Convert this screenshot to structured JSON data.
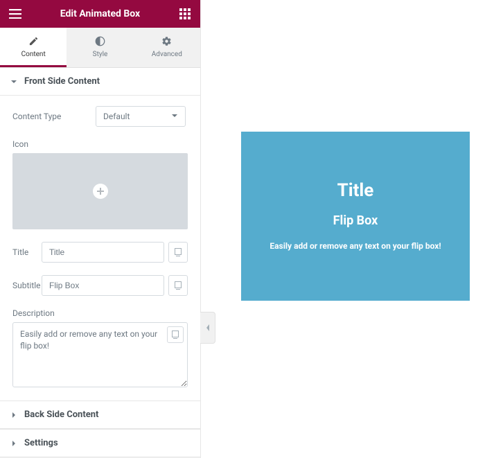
{
  "header": {
    "title": "Edit Animated Box",
    "menu_icon": "hamburger-icon",
    "grid_icon": "grid-icon"
  },
  "tabs": {
    "content": {
      "label": "Content"
    },
    "style": {
      "label": "Style"
    },
    "advanced": {
      "label": "Advanced"
    }
  },
  "sections": {
    "front": {
      "header": "Front Side Content",
      "content_type_label": "Content Type",
      "content_type_value": "Default",
      "icon_label": "Icon",
      "title_label": "Title",
      "title_value": "Title",
      "subtitle_label": "Subtitle",
      "subtitle_value": "Flip Box",
      "description_label": "Description",
      "description_value": "Easily add or remove any text on your flip box!"
    },
    "back": {
      "header": "Back Side Content"
    },
    "settings": {
      "header": "Settings"
    }
  },
  "preview": {
    "title": "Title",
    "subtitle": "Flip Box",
    "description": "Easily add or remove any text on your flip box!",
    "bg_color": "#55acce"
  }
}
